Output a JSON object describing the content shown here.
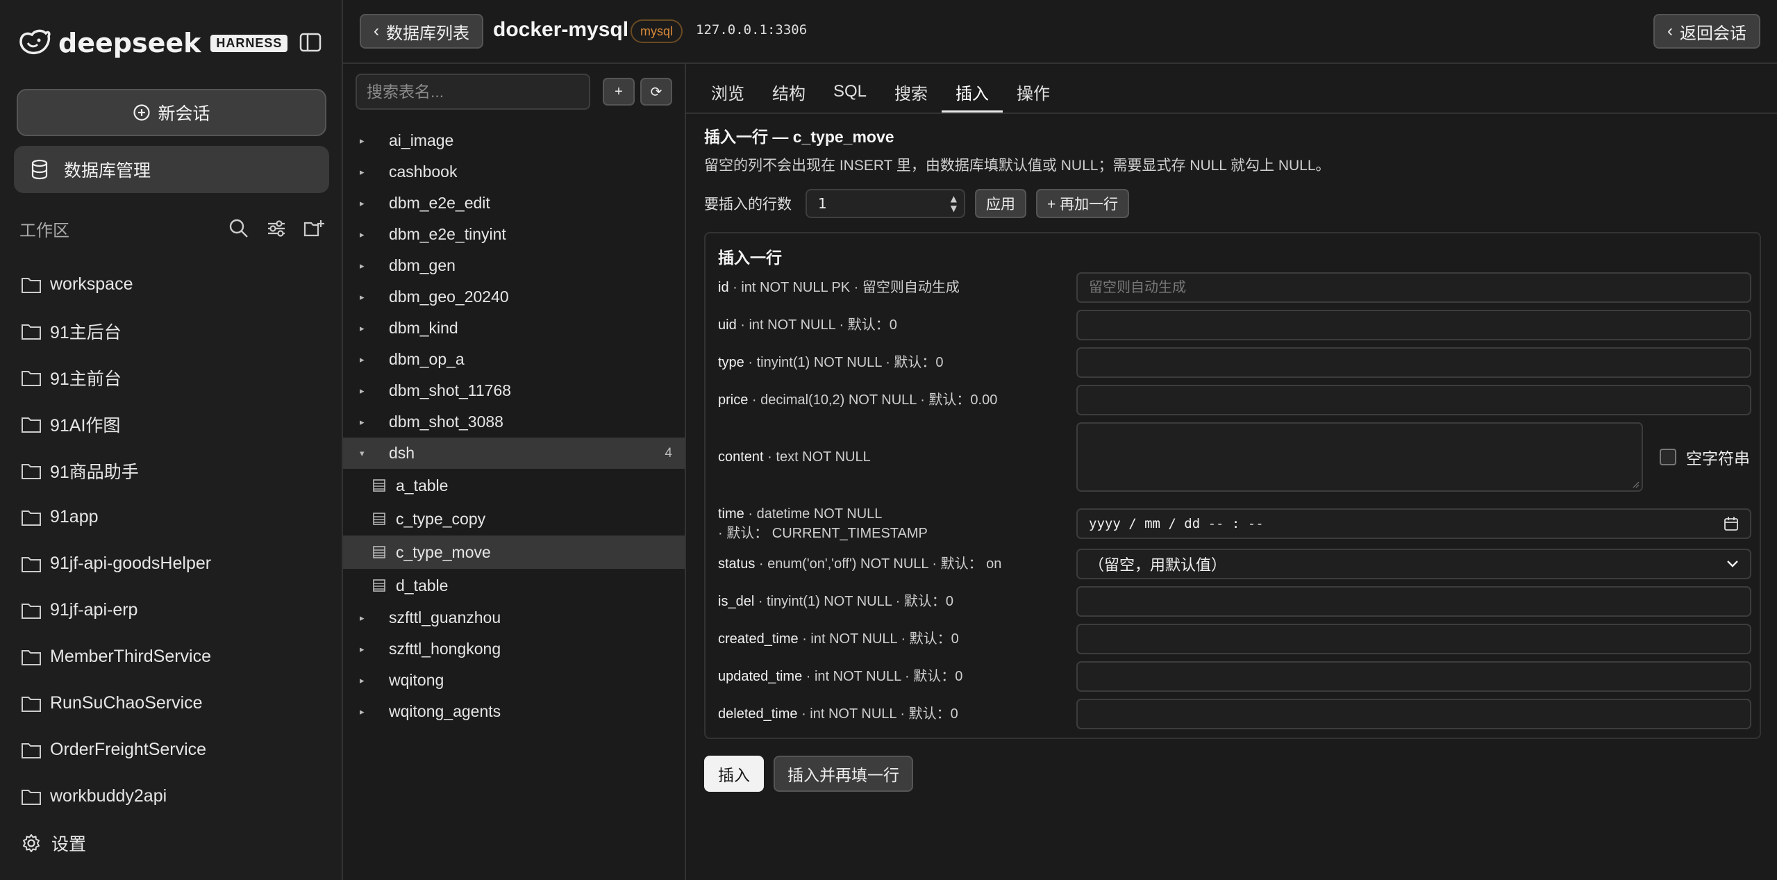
{
  "brand": {
    "name": "deepseek",
    "badge": "HARNESS"
  },
  "sidebar": {
    "new_chat_label": "新会话",
    "db_mgmt_label": "数据库管理",
    "workspace_title": "工作区",
    "workspaces": [
      "workspace",
      "91主后台",
      "91主前台",
      "91AI作图",
      "91商品助手",
      "91app",
      "91jf-api-goodsHelper",
      "91jf-api-erp",
      "MemberThirdService",
      "RunSuChaoService",
      "OrderFreightService",
      "workbuddy2api"
    ],
    "settings_label": "设置"
  },
  "topbar": {
    "back_label": "数据库列表",
    "connection_name": "docker-mysql",
    "engine_badge": "mysql",
    "address": "127.0.0.1:3306",
    "return_label": "返回会话"
  },
  "tree": {
    "search_placeholder": "搜索表名...",
    "add_label": "+",
    "refresh_label": "⟳",
    "databases_before": [
      "ai_image",
      "cashbook",
      "dbm_e2e_edit",
      "dbm_e2e_tinyint",
      "dbm_gen",
      "dbm_geo_20240",
      "dbm_kind",
      "dbm_op_a",
      "dbm_shot_11768",
      "dbm_shot_3088"
    ],
    "open_db": {
      "name": "dsh",
      "count": "4"
    },
    "tables": [
      "a_table",
      "c_type_copy",
      "c_type_move",
      "d_table"
    ],
    "active_table": "c_type_move",
    "databases_after": [
      "szfttl_guanzhou",
      "szfttl_hongkong",
      "wqitong",
      "wqitong_agents"
    ]
  },
  "tabs": [
    "浏览",
    "结构",
    "SQL",
    "搜索",
    "插入",
    "操作"
  ],
  "active_tab": "插入",
  "form": {
    "title": "插入一行 — c_type_move",
    "hint": "留空的列不会出现在 INSERT 里，由数据库填默认值或 NULL；需要显式存 NULL 就勾上 NULL。",
    "rows_label": "要插入的行数",
    "rows_value": "1",
    "apply_label": "应用",
    "add_row_label": "+ 再加一行",
    "card_title": "插入一行",
    "fields": {
      "id": {
        "name": "id",
        "meta": "· int NOT NULL PK · 留空则自动生成",
        "placeholder": "留空则自动生成"
      },
      "uid": {
        "name": "uid",
        "meta": "· int NOT NULL · 默认：0"
      },
      "type": {
        "name": "type",
        "meta": "· tinyint(1) NOT NULL · 默认：0"
      },
      "price": {
        "name": "price",
        "meta": "· decimal(10,2) NOT NULL · 默认：0.00"
      },
      "content": {
        "name": "content",
        "meta": "· text NOT NULL",
        "empty_label": "空字符串"
      },
      "time": {
        "name": "time",
        "meta": "· datetime NOT NULL",
        "meta2": "· 默认： CURRENT_TIMESTAMP",
        "value": "yyyy / mm / dd   -- : --"
      },
      "status": {
        "name": "status",
        "meta": "· enum('on','off') NOT NULL · 默认： on",
        "value": "（留空，用默认值）"
      },
      "is_del": {
        "name": "is_del",
        "meta": "· tinyint(1) NOT NULL · 默认：0"
      },
      "created_time": {
        "name": "created_time",
        "meta": "· int NOT NULL · 默认：0"
      },
      "updated_time": {
        "name": "updated_time",
        "meta": "· int NOT NULL · 默认：0"
      },
      "deleted_time": {
        "name": "deleted_time",
        "meta": "· int NOT NULL · 默认：0"
      }
    },
    "insert_label": "插入",
    "insert_more_label": "插入并再填一行"
  }
}
